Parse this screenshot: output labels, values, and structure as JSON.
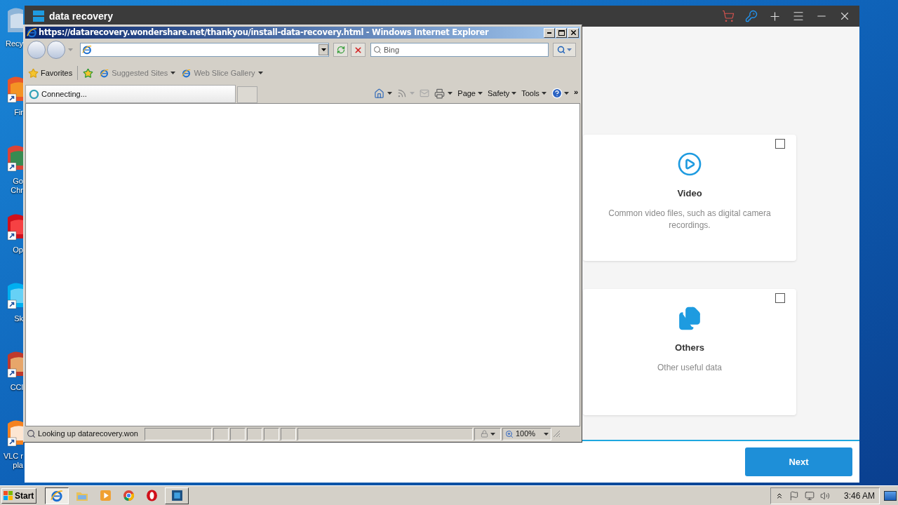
{
  "desktop": {
    "icons": [
      {
        "kind": "recycle",
        "lines": [
          "Recy"
        ]
      },
      {
        "kind": "firefox",
        "lines": [
          "Fir"
        ]
      },
      {
        "kind": "chrome",
        "lines": [
          "Go",
          "Chr"
        ]
      },
      {
        "kind": "opera",
        "lines": [
          "Op"
        ]
      },
      {
        "kind": "skype",
        "lines": [
          "Sk"
        ]
      },
      {
        "kind": "ccleaner",
        "lines": [
          "CCl"
        ]
      },
      {
        "kind": "vlc",
        "lines": [
          "VLC r",
          "pla"
        ]
      }
    ]
  },
  "app_window": {
    "title": "data recovery",
    "categories": [
      {
        "kind": "video",
        "title": "Video",
        "description": "Common video files, such as digital camera recordings.",
        "checked": false
      },
      {
        "kind": "others",
        "title": "Others",
        "description": "Other useful data",
        "checked": false
      }
    ],
    "next_button": "Next"
  },
  "browser_window": {
    "title": "https://datarecovery.wondershare.net/thankyou/install-data-recovery.html - Windows Internet Explorer",
    "search": {
      "placeholder": "Bing"
    },
    "favorites": "Favorites",
    "links": [
      "Suggested Sites",
      "Web Slice Gallery"
    ],
    "tab": "Connecting...",
    "commands": [
      "Page",
      "Safety",
      "Tools"
    ],
    "more": "»",
    "status": "Looking up datarecovery.won",
    "zoom": "100%"
  },
  "taskbar": {
    "start": "Start",
    "apps": [
      {
        "kind": "ie",
        "selected": true
      },
      {
        "kind": "explorer",
        "selected": false
      },
      {
        "kind": "media",
        "selected": false
      },
      {
        "kind": "chrome",
        "selected": false
      },
      {
        "kind": "opera",
        "selected": false
      },
      {
        "kind": "app",
        "selected": false
      }
    ],
    "clock": "3:46 AM"
  }
}
